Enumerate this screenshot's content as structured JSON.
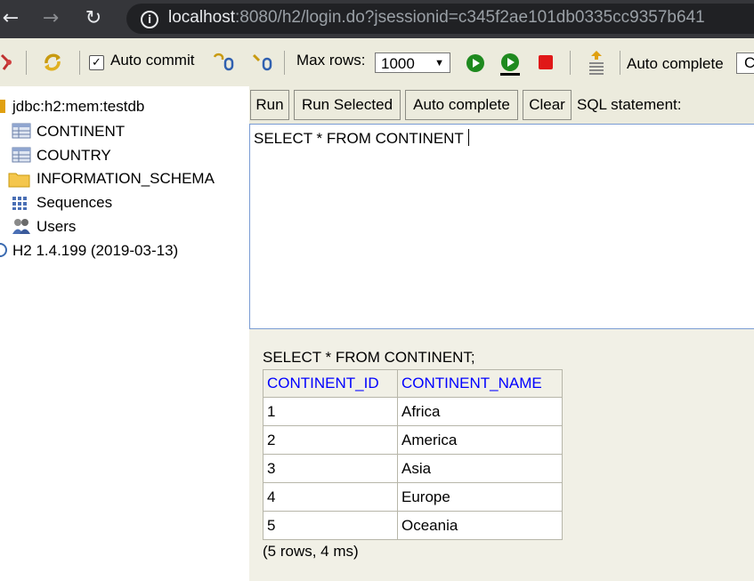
{
  "browser": {
    "url_host": "localhost",
    "url_rest": ":8080/h2/login.do?jsessionid=c345f2ae101db0335cc9357b641"
  },
  "toolbar": {
    "auto_commit_label": "Auto commit",
    "auto_commit_checked": true,
    "max_rows_label": "Max rows:",
    "max_rows_value": "1000",
    "auto_complete_label": "Auto complete",
    "auto_complete_value": "C"
  },
  "tree": {
    "connection": "jdbc:h2:mem:testdb",
    "items": [
      {
        "label": "CONTINENT",
        "icon": "table-icon"
      },
      {
        "label": "COUNTRY",
        "icon": "table-icon"
      },
      {
        "label": "INFORMATION_SCHEMA",
        "icon": "folder-icon"
      },
      {
        "label": "Sequences",
        "icon": "sequence-icon"
      },
      {
        "label": "Users",
        "icon": "users-icon"
      }
    ],
    "version": "H2 1.4.199 (2019-03-13)"
  },
  "query": {
    "buttons": {
      "run": "Run",
      "run_selected": "Run Selected",
      "auto_complete": "Auto complete",
      "clear": "Clear"
    },
    "sql_label": "SQL statement:",
    "sql_text": "SELECT * FROM CONTINENT"
  },
  "results": {
    "statement": "SELECT * FROM CONTINENT;",
    "columns": [
      "CONTINENT_ID",
      "CONTINENT_NAME"
    ],
    "rows": [
      [
        "1",
        "Africa"
      ],
      [
        "2",
        "America"
      ],
      [
        "3",
        "Asia"
      ],
      [
        "4",
        "Europe"
      ],
      [
        "5",
        "Oceania"
      ]
    ],
    "summary": "(5 rows, 4 ms)"
  }
}
